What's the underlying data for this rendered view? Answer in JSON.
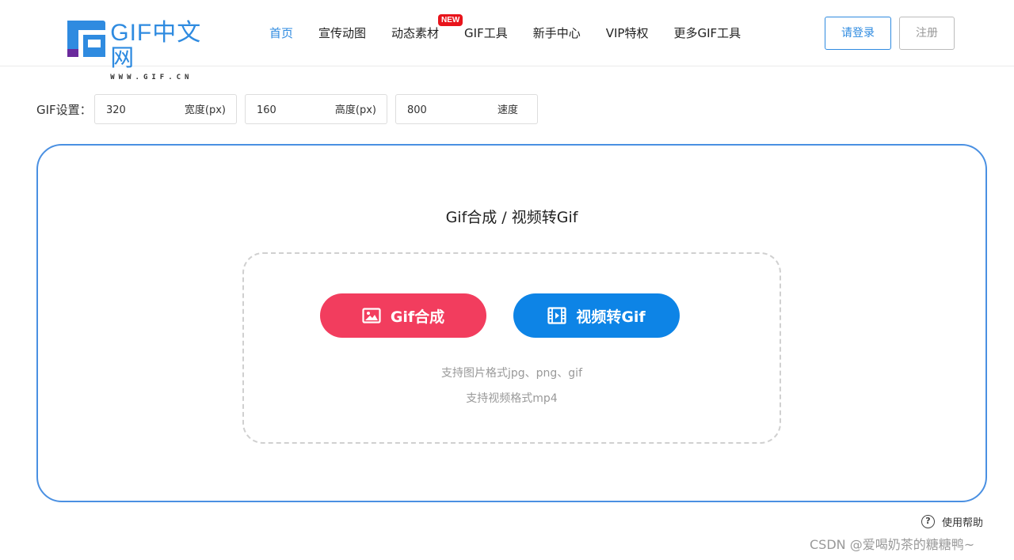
{
  "header": {
    "logo": {
      "title": "GIF中文网",
      "subtitle": "WWW.GIF.CN"
    },
    "nav": [
      {
        "label": "首页",
        "active": true
      },
      {
        "label": "宣传动图"
      },
      {
        "label": "动态素材",
        "badge": "NEW"
      },
      {
        "label": "GIF工具"
      },
      {
        "label": "新手中心"
      },
      {
        "label": "VIP特权"
      },
      {
        "label": "更多GIF工具"
      }
    ],
    "login_label": "请登录",
    "register_label": "注册"
  },
  "settings": {
    "label": "GIF设置：",
    "width": {
      "value": "320",
      "unit": "宽度(px)"
    },
    "height": {
      "value": "160",
      "unit": "高度(px)"
    },
    "speed": {
      "value": "800",
      "unit": "速度"
    }
  },
  "main": {
    "title": "Gif合成 / 视频转Gif",
    "gif_button_label": "Gif合成",
    "video_button_label": "视频转Gif",
    "hint_image": "支持图片格式jpg、png、gif",
    "hint_video": "支持视频格式mp4"
  },
  "help_label": "使用帮助",
  "watermark": "CSDN @爱喝奶茶的糖糖鸭~",
  "colors": {
    "accent": "#2f8be0",
    "gif_button": "#f23d5e",
    "video_button": "#0d84e6",
    "card_border": "#4a90e2",
    "badge": "#e8141b"
  }
}
